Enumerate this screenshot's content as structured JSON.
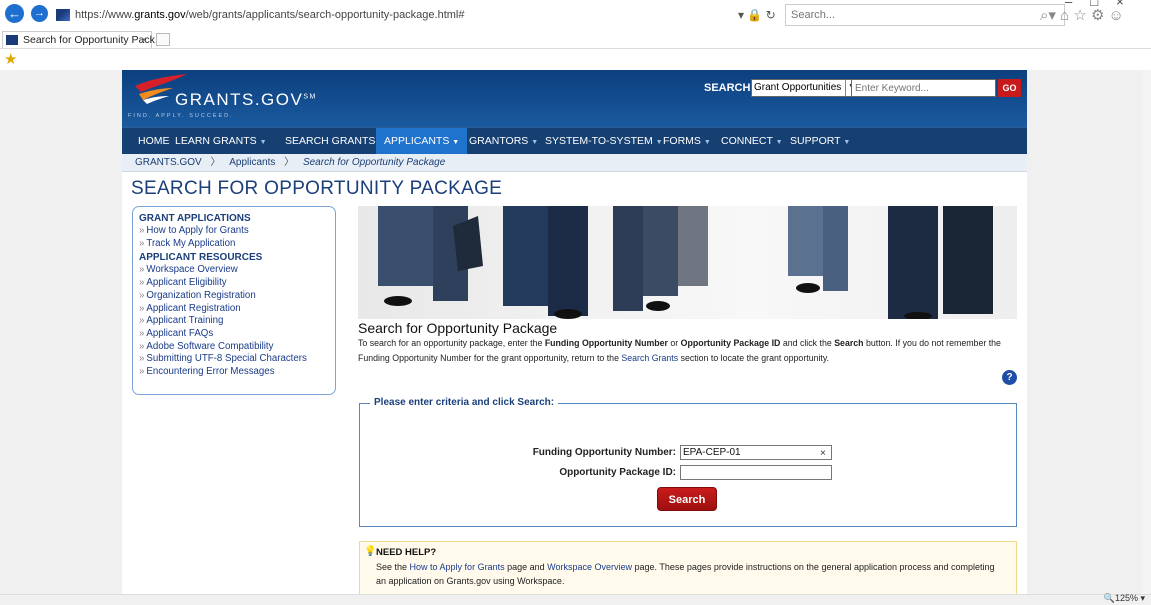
{
  "browser": {
    "url_prefix": "https://www.",
    "url_domain": "grants.gov",
    "url_path": "/web/grants/applicants/search-opportunity-package.html#",
    "addr_icons": "▾ 🔒 ↻",
    "search_placeholder": "Search...",
    "tab_title": "Search for Opportunity Pack...",
    "tab_close": "×",
    "zoom": "🔍125%  ▾",
    "window_controls": "–□×"
  },
  "site": {
    "logo": "GRANTS.GOV",
    "logo_mark": "SM",
    "tagline": "FIND. APPLY. SUCCEED.",
    "search_label": "SEARCH:",
    "search_select": "Grant Opportunities",
    "search_placeholder": "Enter Keyword...",
    "go": "GO"
  },
  "menu": [
    {
      "label": "HOME",
      "caret": ""
    },
    {
      "label": "LEARN GRANTS",
      "caret": "▼"
    },
    {
      "label": "SEARCH GRANTS",
      "caret": ""
    },
    {
      "label": "APPLICANTS",
      "caret": "▼"
    },
    {
      "label": "GRANTORS",
      "caret": "▼"
    },
    {
      "label": "SYSTEM-TO-SYSTEM",
      "caret": "▼"
    },
    {
      "label": "FORMS",
      "caret": "▼"
    },
    {
      "label": "CONNECT",
      "caret": "▼"
    },
    {
      "label": "SUPPORT",
      "caret": "▼"
    }
  ],
  "breadcrumb": {
    "home": "GRANTS.GOV",
    "applicants": "Applicants",
    "current": "Search for Opportunity Package",
    "sep": "〉"
  },
  "page_title": "SEARCH FOR OPPORTUNITY PACKAGE",
  "sidebar": {
    "heading1": "GRANT APPLICATIONS",
    "links1": [
      "How to Apply for Grants",
      "Track My Application"
    ],
    "heading2": "APPLICANT RESOURCES",
    "links2": [
      "Workspace Overview",
      "Applicant Eligibility",
      "Organization Registration",
      "Applicant Registration",
      "Applicant Training",
      "Applicant FAQs",
      "Adobe Software Compatibility",
      "Submitting UTF-8 Special Characters",
      "Encountering Error Messages"
    ]
  },
  "content": {
    "title": "Search for Opportunity Package",
    "p1": "To search for an opportunity package, enter the ",
    "b1": "Funding Opportunity Number",
    "p2": " or ",
    "b2": "Opportunity Package ID",
    "p3": " and click the ",
    "b3": "Search",
    "p4": " button. If you do not remember the Funding Opportunity Number for the grant opportunity, return to the ",
    "link": "Search Grants",
    "p5": " section to locate the grant opportunity.",
    "help": "?"
  },
  "criteria": {
    "legend": "Please enter criteria and click Search:",
    "fon_label": "Funding Opportunity Number:",
    "fon_value": "EPA-CEP-01",
    "clear": "×",
    "pkg_label": "Opportunity Package ID:",
    "pkg_value": "",
    "search_button": "Search"
  },
  "needhelp": {
    "title": "NEED HELP?",
    "t1": "See the ",
    "link1": "How to Apply for Grants",
    "t2": " page and ",
    "link2": "Workspace Overview",
    "t3": " page. These pages provide instructions on the general application process and completing an application on Grants.gov using Workspace."
  }
}
